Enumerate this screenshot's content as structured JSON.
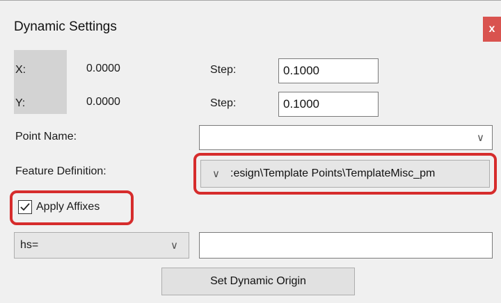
{
  "window": {
    "title": "Dynamic Settings",
    "close_label": "x"
  },
  "coords": {
    "x_label": "X:",
    "x_value": "0.0000",
    "y_label": "Y:",
    "y_value": "0.0000"
  },
  "steps": {
    "x_label": "Step:",
    "x_value": "0.1000",
    "y_label": "Step:",
    "y_value": "0.1000"
  },
  "point_name": {
    "label": "Point Name:",
    "value": ""
  },
  "feature_definition": {
    "label": "Feature Definition:",
    "value": ":esign\\Template Points\\TemplateMisc_pm"
  },
  "apply_affixes": {
    "label": "Apply Affixes",
    "checked": true
  },
  "affix": {
    "mode_value": "hs=",
    "text_value": ""
  },
  "set_origin_button": "Set Dynamic Origin",
  "colors": {
    "highlight": "#d62c2c",
    "close_button": "#d9534f",
    "background": "#f0f0f0"
  }
}
